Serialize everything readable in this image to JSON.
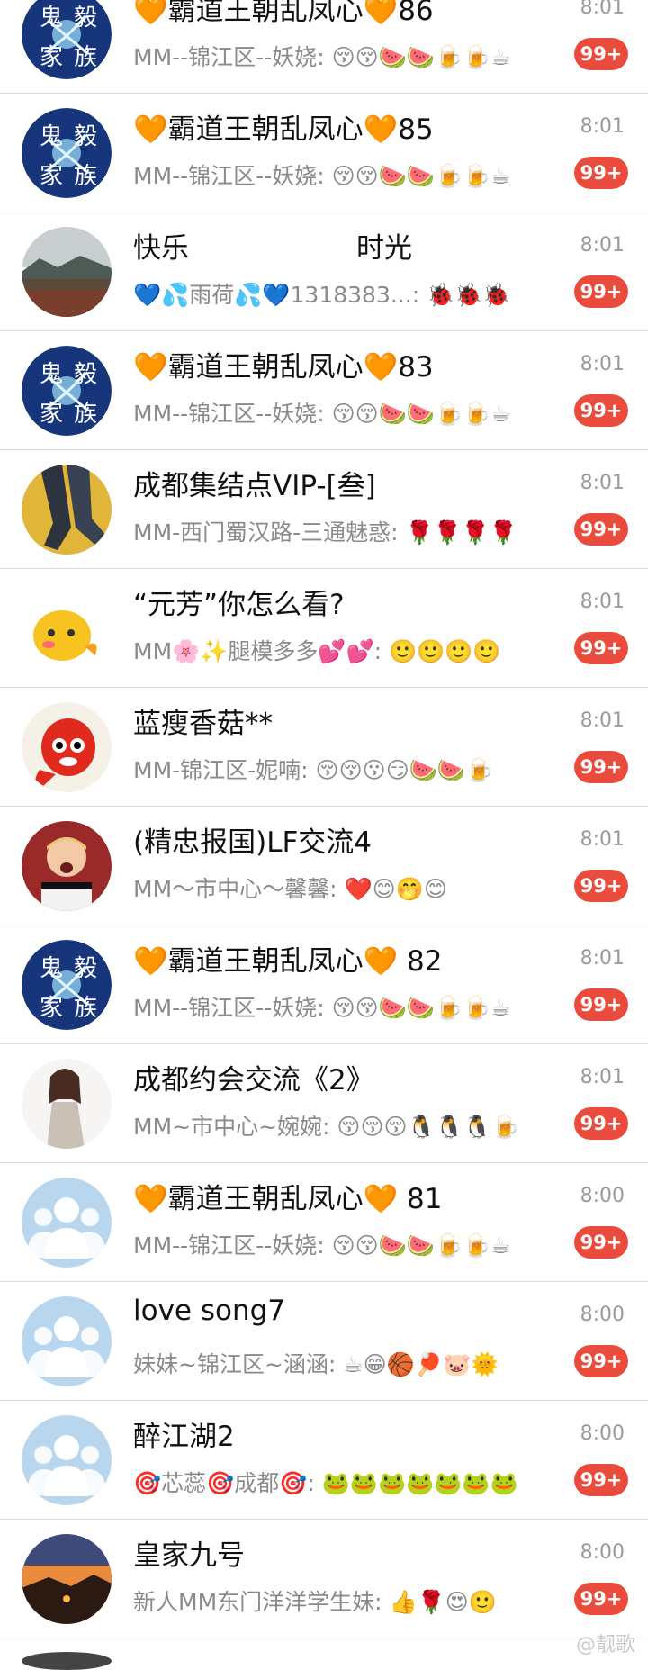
{
  "colors": {
    "badge": "#e94b3c",
    "divider": "#d9d9d9",
    "default_avatar_bg": "#b8d6ee"
  },
  "chats": [
    {
      "title": "🧡霸道王朝乱凤心🧡86",
      "preview": "MM--锦江区--妖娆: 😚😚🍉🍉🍺🍺☕",
      "time": "8:01",
      "badge": "99+",
      "avatar": "guiyi-family-logo"
    },
    {
      "title": "🧡霸道王朝乱凤心🧡85",
      "preview": "MM--锦江区--妖娆: 😚😚🍉🍉🍺🍺☕",
      "time": "8:01",
      "badge": "99+",
      "avatar": "guiyi-family-logo"
    },
    {
      "title": "快乐　　　　　　时光",
      "preview": "💙💦雨荷💦💙1318383...: 🐞🐞🐞",
      "time": "8:01",
      "badge": "99+",
      "avatar": "landscape-photo"
    },
    {
      "title": "🧡霸道王朝乱凤心🧡83",
      "preview": "MM--锦江区--妖娆: 😚😚🍉🍉🍺🍺☕",
      "time": "8:01",
      "badge": "99+",
      "avatar": "guiyi-family-logo"
    },
    {
      "title": "成都集结点VIP-[叁]",
      "preview": "MM-西门蜀汉路-三通魅惑: 🌹🌹🌹🌹",
      "time": "8:01",
      "badge": "99+",
      "avatar": "legs-photo"
    },
    {
      "title": "“元芳”你怎么看?",
      "preview": "MM🌸✨腿模多多💕💕: 🙂🙂🙂🙂",
      "time": "8:01",
      "badge": "99+",
      "avatar": "cartoon-chick"
    },
    {
      "title": "蓝瘦香菇**",
      "preview": "MM-锦江区-妮喃: 😚😚😗😏🍉🍉🍺",
      "time": "8:01",
      "badge": "99+",
      "avatar": "red-cartoon"
    },
    {
      "title": "(精忠报国)LF交流4",
      "preview": "MM～市中心～馨馨: ❤️😊🤭😊",
      "time": "8:01",
      "badge": "99+",
      "avatar": "child-photo"
    },
    {
      "title": "🧡霸道王朝乱凤心🧡 82",
      "preview": "MM--锦江区--妖娆: 😚😚🍉🍉🍺🍺☕",
      "time": "8:01",
      "badge": "99+",
      "avatar": "guiyi-family-logo"
    },
    {
      "title": "成都约会交流《2》",
      "preview": "MM~市中心~婉婉: 😚😚😚🐧🐧🐧🍺",
      "time": "8:01",
      "badge": "99+",
      "avatar": "woman-photo"
    },
    {
      "title": "🧡霸道王朝乱凤心🧡 81",
      "preview": "MM--锦江区--妖娆: 😚😚🍉🍉🍺🍺☕",
      "time": "8:00",
      "badge": "99+",
      "avatar": "default-group-avatar"
    },
    {
      "title": "love song7",
      "preview": "妹妹~锦江区~涵涵: ☕😁🏀🏓🐷🌞",
      "time": "8:00",
      "badge": "99+",
      "avatar": "default-group-avatar"
    },
    {
      "title": "醉江湖2",
      "preview": "🎯芯蕊🎯成都🎯: 🐸🐸🐸🐸🐸🐸🐸",
      "time": "8:00",
      "badge": "99+",
      "avatar": "default-group-avatar"
    },
    {
      "title": "皇家九号",
      "preview": "新人MM东门洋洋学生妹: 👍🌹😍🙂",
      "time": "8:00",
      "badge": "99+",
      "avatar": "sunset-photo"
    }
  ],
  "watermark": "@靓歌"
}
